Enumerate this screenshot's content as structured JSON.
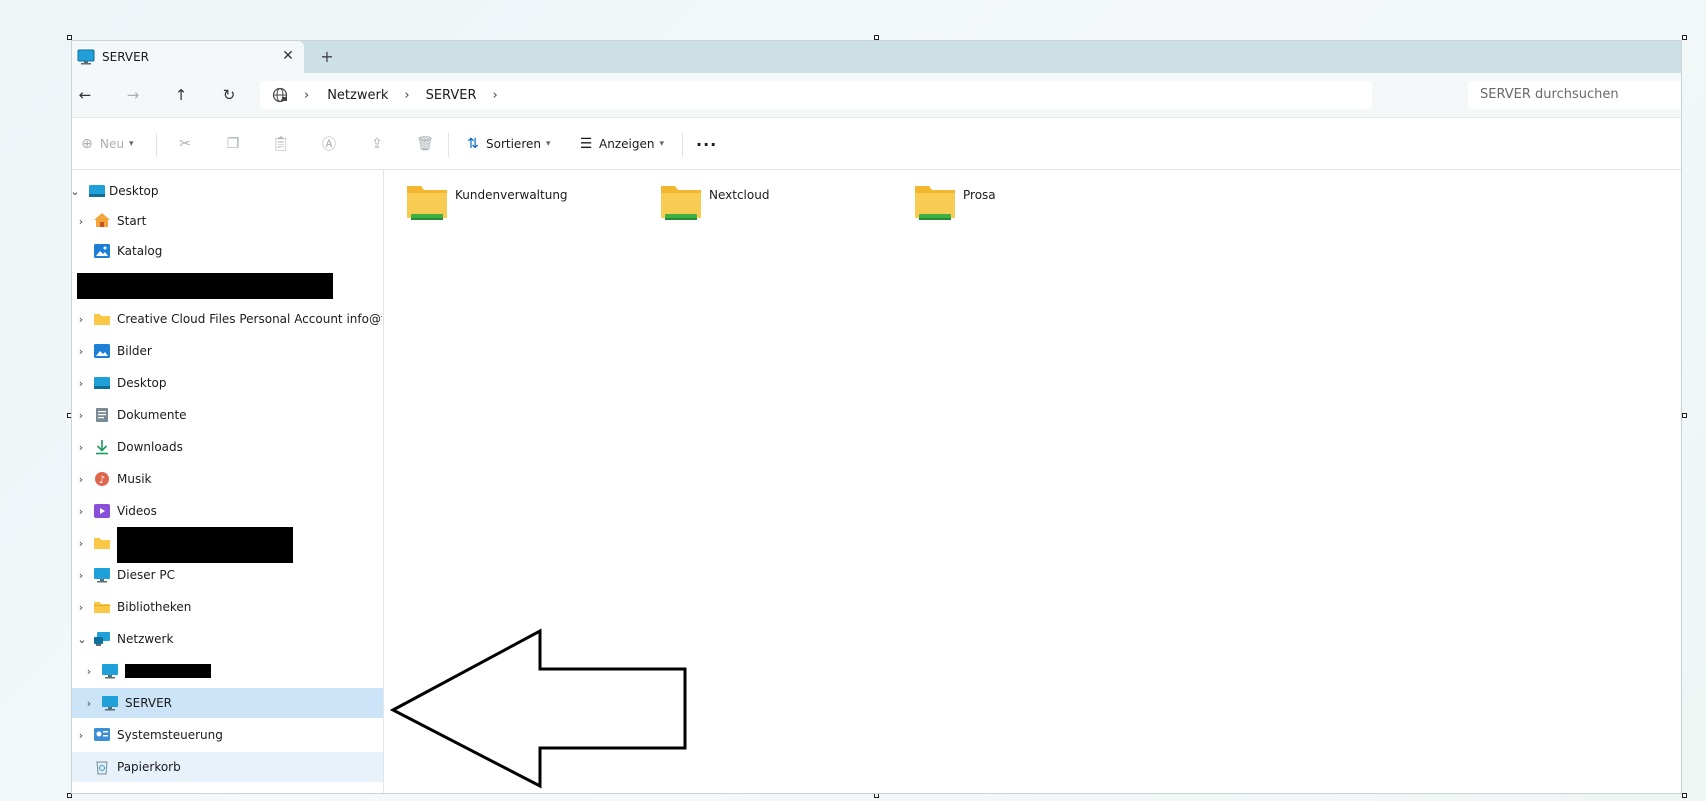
{
  "window": {
    "tab_title": "SERVER",
    "tab_close": "✕",
    "new_tab": "+"
  },
  "navigation": {
    "back": "←",
    "forward": "→",
    "up": "↑",
    "refresh": "↻",
    "breadcrumb": [
      "Netzwerk",
      "SERVER"
    ],
    "search_placeholder": "SERVER durchsuchen"
  },
  "toolbar": {
    "new_label": "Neu",
    "sort_label": "Sortieren",
    "view_label": "Anzeigen",
    "more_label": "···"
  },
  "sidebar": {
    "items": [
      {
        "label": "Desktop"
      },
      {
        "label": "Start"
      },
      {
        "label": "Katalog"
      },
      {
        "label": "Creative Cloud Files Personal Account info@finan"
      },
      {
        "label": "Bilder"
      },
      {
        "label": "Desktop"
      },
      {
        "label": "Dokumente"
      },
      {
        "label": "Downloads"
      },
      {
        "label": "Musik"
      },
      {
        "label": "Videos"
      },
      {
        "label": "Dieser PC"
      },
      {
        "label": "Bibliotheken"
      },
      {
        "label": "Netzwerk"
      },
      {
        "label": "SERVER"
      },
      {
        "label": "Systemsteuerung"
      },
      {
        "label": "Papierkorb"
      }
    ]
  },
  "folders": [
    {
      "name": "Kundenverwaltung"
    },
    {
      "name": "Nextcloud"
    },
    {
      "name": "Prosa"
    }
  ],
  "colors": {
    "accent": "#0067c0",
    "selection": "#cce4f7",
    "folder": "#f8c846",
    "share_bar": "#3cb043"
  }
}
